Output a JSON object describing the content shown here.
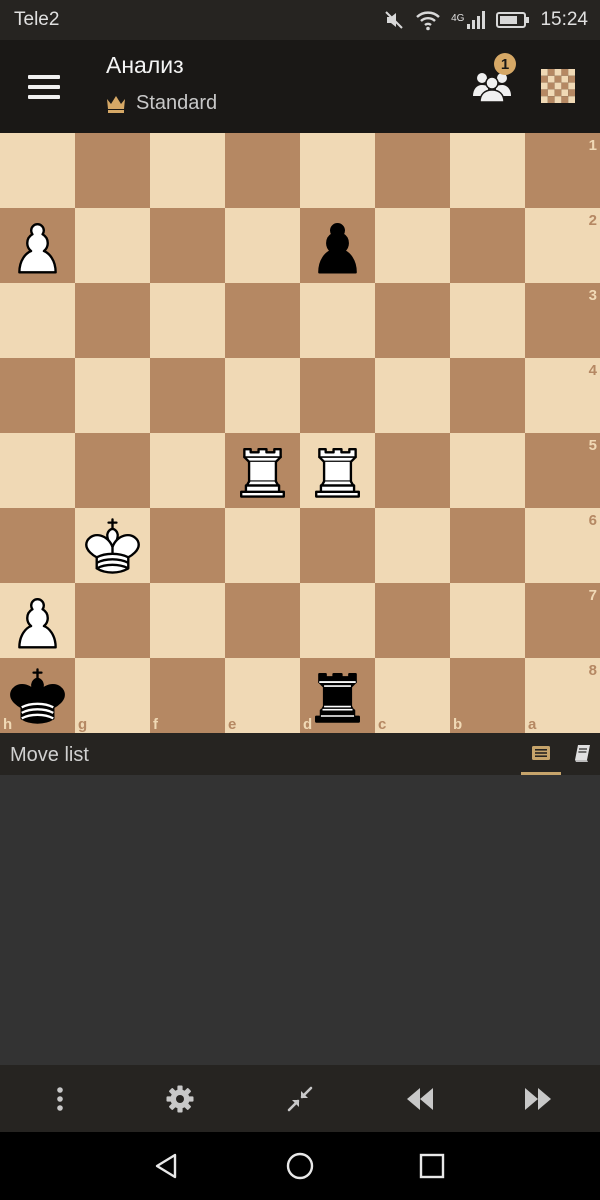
{
  "status_bar": {
    "carrier": "Tele2",
    "network": "4G",
    "time": "15:24"
  },
  "app_bar": {
    "title": "Анализ",
    "variant": "Standard",
    "friends_badge": "1",
    "icons": {
      "menu": "hamburger-menu-icon",
      "variant": "crown-icon",
      "friends": "friends-icon",
      "board": "board-icon"
    }
  },
  "board": {
    "orientation": "black",
    "rank_labels": [
      "1",
      "2",
      "3",
      "4",
      "5",
      "6",
      "7",
      "8"
    ],
    "file_labels": [
      "h",
      "g",
      "f",
      "e",
      "d",
      "c",
      "b",
      "a"
    ],
    "colors": {
      "light": "#f0d9b5",
      "dark": "#b58863"
    },
    "pieces": [
      {
        "square": "h2",
        "piece": "pawn",
        "color": "white"
      },
      {
        "square": "d2",
        "piece": "pawn",
        "color": "black"
      },
      {
        "square": "e5",
        "piece": "rook",
        "color": "white"
      },
      {
        "square": "d5",
        "piece": "rook",
        "color": "white"
      },
      {
        "square": "g6",
        "piece": "king",
        "color": "white"
      },
      {
        "square": "h7",
        "piece": "pawn",
        "color": "white"
      },
      {
        "square": "h8",
        "piece": "king",
        "color": "black"
      },
      {
        "square": "d8",
        "piece": "rook",
        "color": "black"
      }
    ]
  },
  "panel": {
    "title": "Move list",
    "tabs": [
      {
        "icon": "move-list-icon",
        "active": true
      },
      {
        "icon": "opening-book-icon",
        "active": false
      }
    ]
  },
  "toolbar": [
    "more-vertical-icon",
    "settings-gear-icon",
    "minimize-arrows-icon",
    "rewind-icon",
    "fast-forward-icon"
  ],
  "nav_bar": [
    "back-triangle-icon",
    "home-circle-icon",
    "recents-square-icon"
  ],
  "accent_color": "#d6a866"
}
